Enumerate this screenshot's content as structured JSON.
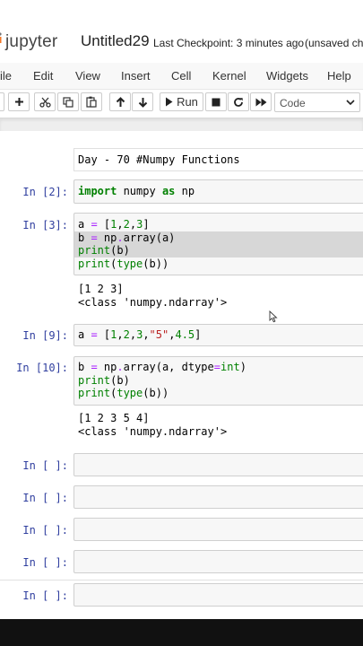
{
  "header": {
    "logo_text": "jupyter",
    "notebook_title": "Untitled29",
    "checkpoint": "Last Checkpoint: 3 minutes ago",
    "unsaved": "(unsaved cha",
    "brand_color": "#f37726"
  },
  "menu": {
    "items": [
      "ile",
      "Edit",
      "View",
      "Insert",
      "Cell",
      "Kernel",
      "Widgets",
      "Help"
    ]
  },
  "toolbar": {
    "icons": [
      "save-icon",
      "plus-icon",
      "scissors-icon",
      "copy-icon",
      "paste-icon",
      "arrow-up-icon",
      "arrow-down-icon",
      "run-icon",
      "stop-icon",
      "restart-icon",
      "fast-forward-icon"
    ],
    "run_label": "Run",
    "cell_type": "Code"
  },
  "markdown_cell": {
    "text": "Day - 70 #Numpy Functions"
  },
  "cells": [
    {
      "prompt": "In [2]:"
    },
    {
      "prompt": "In [3]:",
      "output": [
        "[1 2 3]",
        "<class 'numpy.ndarray'>"
      ]
    },
    {
      "prompt": "In [9]:"
    },
    {
      "prompt": "In [10]:",
      "output": [
        "[1 2 3 5 4]",
        "<class 'numpy.ndarray'>"
      ]
    },
    {
      "prompt": "In [ ]:"
    },
    {
      "prompt": "In [ ]:"
    },
    {
      "prompt": "In [ ]:"
    },
    {
      "prompt": "In [ ]:"
    },
    {
      "prompt": "In [ ]:"
    }
  ],
  "code": {
    "c2": {
      "kw_import": "import",
      "mod": " numpy ",
      "kw_as": "as",
      "alias": " np"
    },
    "c3": {
      "l1_a": "a ",
      "l1_eq": "=",
      "l1_b": " [",
      "l1_n1": "1",
      "l1_c1": ",",
      "l1_n2": "2",
      "l1_c2": ",",
      "l1_n3": "3",
      "l1_e": "]",
      "l2_a": "b ",
      "l2_eq": "=",
      "l2_b": " np",
      "l2_dot": ".",
      "l2_c": "array(a)",
      "l3_f": "print",
      "l3_r": "(b)",
      "l4_f": "print",
      "l4_p": "(",
      "l4_t": "type",
      "l4_r": "(b))"
    },
    "c9": {
      "a": "a ",
      "eq": "=",
      "b": " [",
      "n1": "1",
      "c1": ",",
      "n2": "2",
      "c2": ",",
      "n3": "3",
      "c3": ",",
      "s": "\"5\"",
      "c4": ",",
      "n4": "4.5",
      "e": "]"
    },
    "c10": {
      "l1_a": "b ",
      "l1_eq": "=",
      "l1_b": " np",
      "l1_dot": ".",
      "l1_c": "array(a, dtype",
      "l1_eq2": "=",
      "l1_int": "int",
      "l1_e": ")",
      "l2_f": "print",
      "l2_r": "(b)",
      "l3_f": "print",
      "l3_p": "(",
      "l3_t": "type",
      "l3_r": "(b))"
    }
  }
}
